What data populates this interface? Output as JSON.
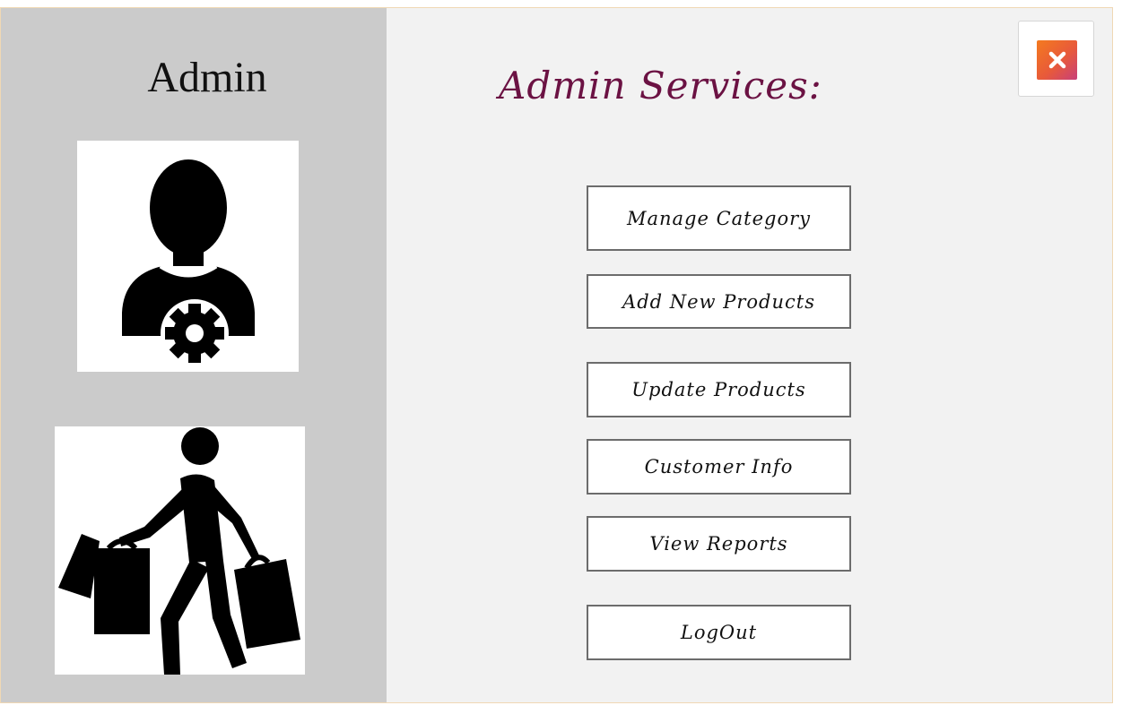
{
  "sidebar": {
    "title": "Admin",
    "images": [
      {
        "icon": "admin-settings-icon"
      },
      {
        "icon": "shopper-icon"
      }
    ]
  },
  "main": {
    "title": "Admin Services:"
  },
  "menu": {
    "manage_category": "Manage Category",
    "add_new_products": "Add New Products",
    "update_products": "Update Products",
    "customer_info": "Customer Info",
    "view_reports": "View Reports",
    "logout": "LogOut"
  },
  "close": {
    "icon": "close-icon"
  },
  "colors": {
    "sidebar_bg": "#cbcbcb",
    "main_bg": "#f2f2f2",
    "title_color": "#6b1243",
    "close_gradient_start": "#f47a1f",
    "close_gradient_end": "#c8407a"
  }
}
